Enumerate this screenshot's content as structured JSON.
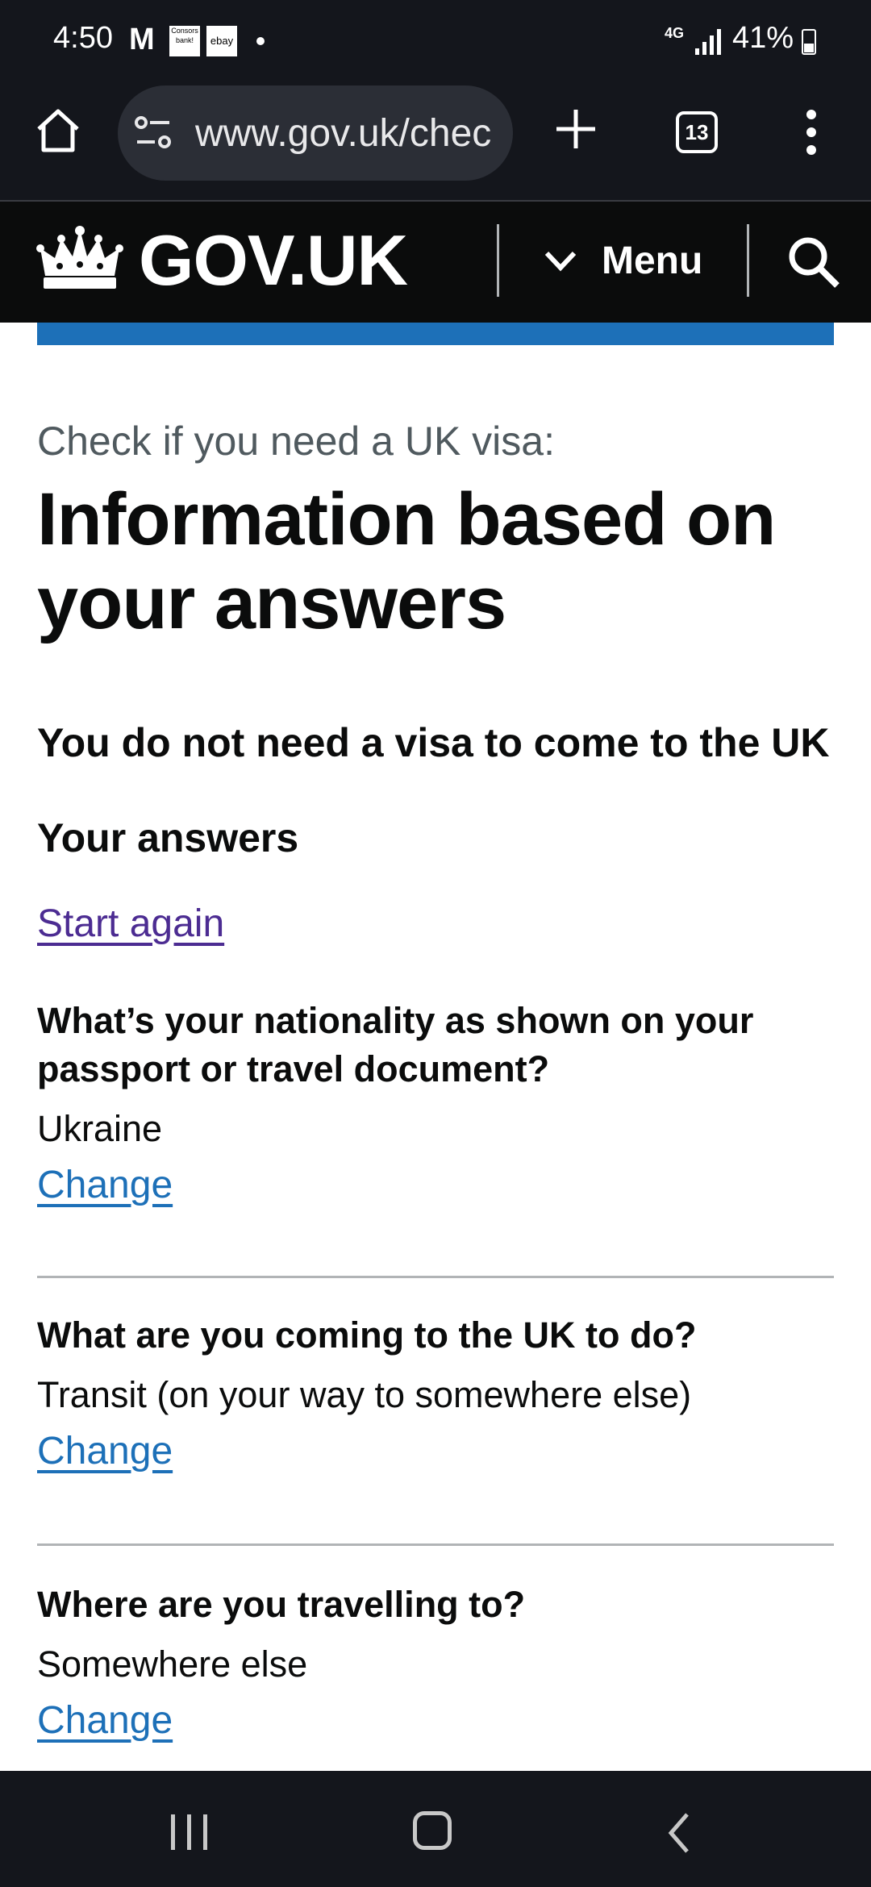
{
  "status_bar": {
    "time": "4:50",
    "mail_icon": "M",
    "app_icon_1": "Consors bank!",
    "app_icon_2": "ebay",
    "network": "4G",
    "battery": "41%"
  },
  "browser": {
    "url": "www.gov.uk/chec",
    "tab_count": "13"
  },
  "govuk_header": {
    "logo_text": "GOV.UK",
    "menu_label": "Menu"
  },
  "page": {
    "caption": "Check if you need a UK visa:",
    "title": "Information based on your answers",
    "outcome": "You do not need a visa to come to the UK",
    "answers_heading": "Your answers",
    "start_again": "Start again"
  },
  "answers": [
    {
      "question": "What’s your nationality as shown on your passport or travel document?",
      "answer": "Ukraine",
      "change_label": "Change"
    },
    {
      "question": "What are you coming to the UK to do?",
      "answer": "Transit (on your way to somewhere else)",
      "change_label": "Change"
    },
    {
      "question": "Where are you travelling to?",
      "answer": "Somewhere else",
      "change_label": "Change"
    }
  ],
  "colors": {
    "govuk_black": "#0b0c0c",
    "govuk_blue": "#1d70b8",
    "link_visited": "#4c2c92",
    "divider": "#b1b4b6"
  }
}
